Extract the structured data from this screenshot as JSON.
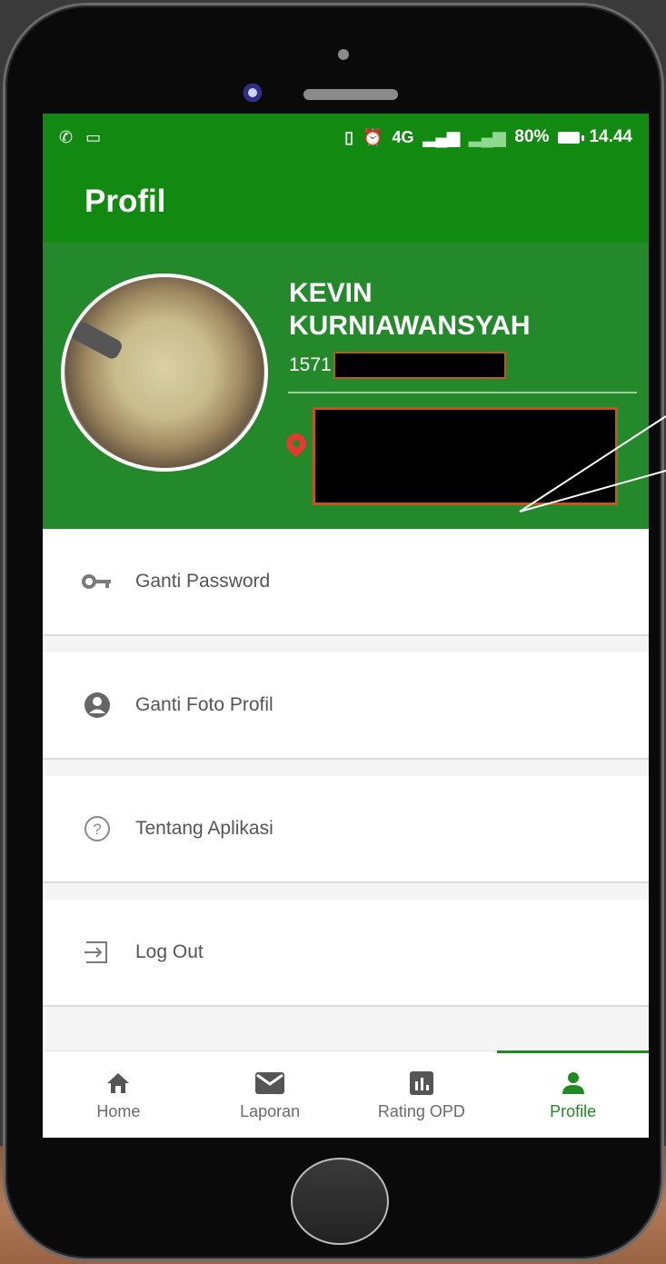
{
  "status_bar": {
    "battery": "80%",
    "time": "14.44",
    "network": "4G"
  },
  "toolbar": {
    "title": "Profil"
  },
  "profile": {
    "name_line1": "KEVIN",
    "name_line2": "KURNIAWANSYAH",
    "nik_prefix": "1571"
  },
  "menu": {
    "items": [
      {
        "label": "Ganti Password",
        "icon": "key-icon"
      },
      {
        "label": "Ganti Foto Profil",
        "icon": "account-circle-icon"
      },
      {
        "label": "Tentang Aplikasi",
        "icon": "help-circle-icon"
      },
      {
        "label": "Log Out",
        "icon": "logout-icon"
      }
    ]
  },
  "bottom_nav": {
    "items": [
      {
        "label": "Home",
        "icon": "home-icon"
      },
      {
        "label": "Laporan",
        "icon": "mail-icon"
      },
      {
        "label": "Rating OPD",
        "icon": "bar-chart-icon"
      },
      {
        "label": "Profile",
        "icon": "person-icon",
        "active": true
      }
    ]
  },
  "colors": {
    "primary": "#128a12",
    "header": "#23892a",
    "accent_pin": "#e53935",
    "redaction_border": "#c0571a"
  }
}
